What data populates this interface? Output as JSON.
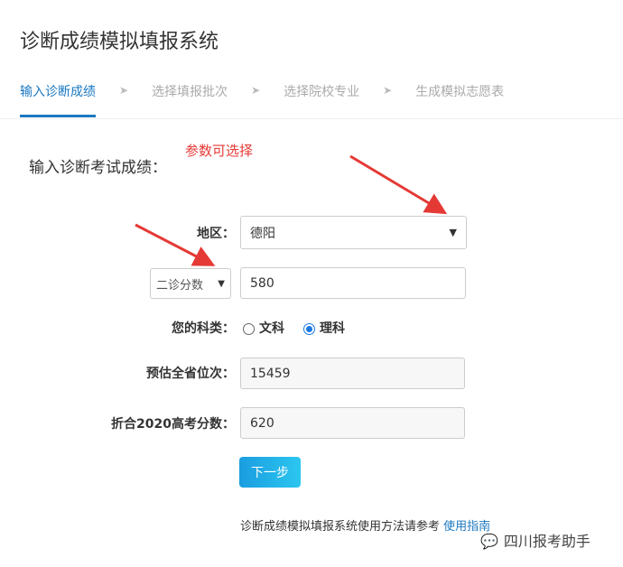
{
  "app": {
    "title": "诊断成绩模拟填报系统"
  },
  "steps": [
    {
      "label": "输入诊断成绩",
      "active": true
    },
    {
      "label": "选择填报批次"
    },
    {
      "label": "选择院校专业"
    },
    {
      "label": "生成模拟志愿表"
    }
  ],
  "form": {
    "heading": "输入诊断考试成绩：",
    "annotation": "参数可选择",
    "region_label": "地区：",
    "region_value": "德阳",
    "exam_select": "二诊分数",
    "score_value": "580",
    "subject_label": "您的科类：",
    "subject_options": [
      "文科",
      "理科"
    ],
    "subject_selected": "理科",
    "rank_label": "预估全省位次：",
    "rank_value": "15459",
    "converted_label": "折合2020高考分数：",
    "converted_value": "620",
    "next_button": "下一步"
  },
  "footer": {
    "text": "诊断成绩模拟填报系统使用方法请参考",
    "link": "使用指南",
    "watermark": "四川报考助手"
  },
  "colors": {
    "accent": "#1a78c2",
    "annotation": "#e53935"
  }
}
